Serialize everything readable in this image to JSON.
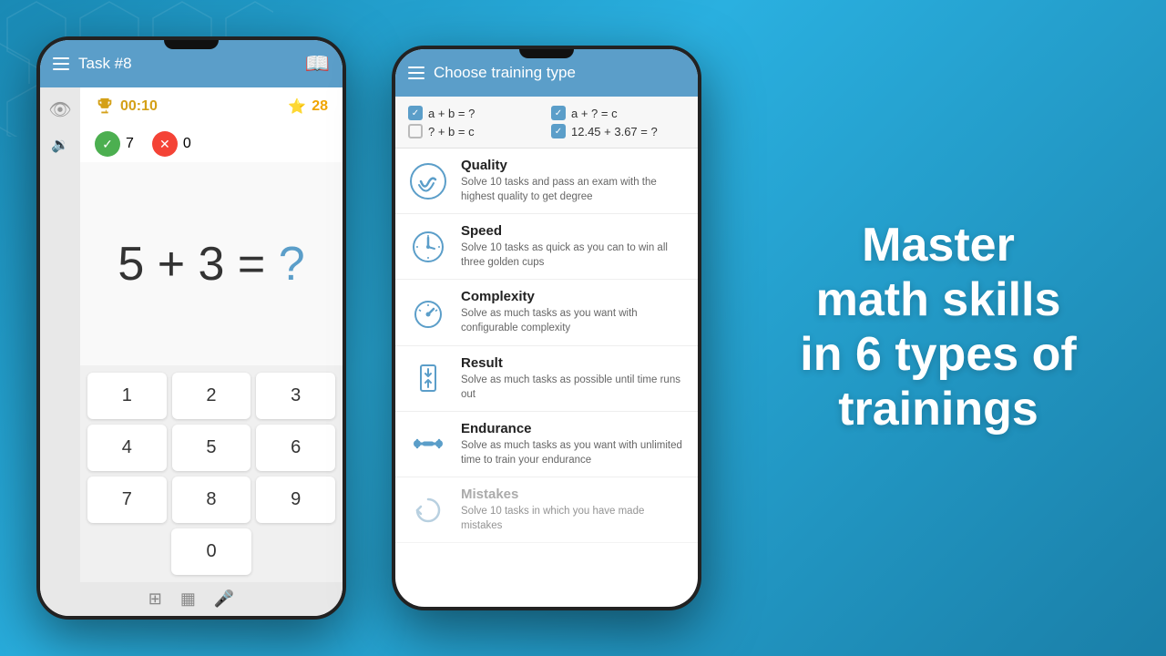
{
  "background": {
    "color": "#2196c4"
  },
  "phone1": {
    "appbar": {
      "menu_label": "≡",
      "title": "Task #8",
      "book_icon": "📖"
    },
    "stats": {
      "timer": "00:10",
      "score": "28"
    },
    "correct": "7",
    "wrong": "0",
    "equation": "5 + 3 = ",
    "question_mark": "?",
    "numpad": {
      "keys": [
        "1",
        "2",
        "3",
        "4",
        "5",
        "6",
        "7",
        "8",
        "9"
      ],
      "zero": "0"
    }
  },
  "phone2": {
    "appbar": {
      "menu_label": "≡",
      "title": "Choose training type"
    },
    "checkboxes": [
      {
        "label": "a + b = ?",
        "checked": true
      },
      {
        "label": "a + ? = c",
        "checked": true
      },
      {
        "label": "? + b = c",
        "checked": false
      },
      {
        "label": "12.45 + 3.67 = ?",
        "checked": true
      }
    ],
    "training_types": [
      {
        "name": "Quality",
        "desc": "Solve 10 tasks and pass an exam with the highest quality to get degree",
        "icon": "thumbs_up"
      },
      {
        "name": "Speed",
        "desc": "Solve 10 tasks as quick as you can to win all three golden cups",
        "icon": "timer"
      },
      {
        "name": "Complexity",
        "desc": "Solve as much tasks as you want with configurable complexity",
        "icon": "speedometer"
      },
      {
        "name": "Result",
        "desc": "Solve as much tasks as possible until time runs out",
        "icon": "hourglass"
      },
      {
        "name": "Endurance",
        "desc": "Solve as much tasks as you want with unlimited time to train your endurance",
        "icon": "dumbbell"
      },
      {
        "name": "Mistakes",
        "desc": "Solve 10 tasks in which you have made mistakes",
        "icon": "history"
      }
    ]
  },
  "right_text": {
    "line1": "Master",
    "line2": "math skills",
    "line3": "in 6 types of",
    "line4": "trainings"
  }
}
